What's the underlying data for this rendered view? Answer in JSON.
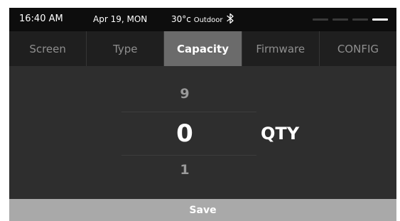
{
  "status": {
    "time": "16:40 AM",
    "date": "Apr 19, MON",
    "temperature": "30°c",
    "temperature_label": "Outdoor",
    "bluetooth_icon": "bluetooth-icon",
    "page_count": 4,
    "active_page": 4
  },
  "tabs": [
    {
      "label": "Screen",
      "active": false
    },
    {
      "label": "Type",
      "active": false
    },
    {
      "label": "Capacity",
      "active": true
    },
    {
      "label": "Firmware",
      "active": false
    },
    {
      "label": "CONFIG",
      "active": false
    }
  ],
  "picker": {
    "above": "9",
    "current": "0",
    "below": "1",
    "unit": "QTY"
  },
  "actions": {
    "save_label": "Save"
  },
  "colors": {
    "screen_bg": "#2e2e2e",
    "statusbar_bg": "#0d0d0d",
    "tabbar_bg": "#1f1f1f",
    "tab_active_bg": "#6b6b6b",
    "save_bg": "#a9a9a9"
  }
}
